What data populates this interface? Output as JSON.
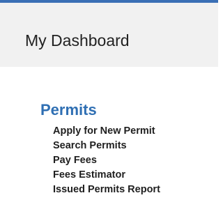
{
  "dashboard": {
    "title": "My Dashboard"
  },
  "permits": {
    "heading": "Permits",
    "items": [
      {
        "label": "Apply for New Permit"
      },
      {
        "label": "Search Permits"
      },
      {
        "label": "Pay Fees"
      },
      {
        "label": "Fees Estimator"
      },
      {
        "label": "Issued Permits Report"
      }
    ]
  },
  "colors": {
    "accent_bar": "#3a6fb5",
    "heading": "#2f6fb3",
    "panel_background": "#f1f1f1",
    "text": "#1f1f1f"
  }
}
